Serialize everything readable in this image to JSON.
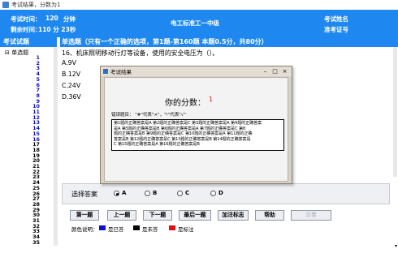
{
  "window": {
    "title": "考试结果，分数为1"
  },
  "header": {
    "exam_time_label": "考试时间：",
    "exam_time_value": "120",
    "exam_time_unit": "分钟",
    "remaining_label": "剩余时间：",
    "remaining_value": "110 分 23秒",
    "center_title": "电工标准工一中级",
    "name_label": "考试姓名",
    "id_label": "准考证号"
  },
  "sidebar": {
    "title": "考试试题",
    "root": "单选题",
    "numbers": [
      "1",
      "2",
      "3",
      "4",
      "5",
      "6",
      "7",
      "8",
      "9",
      "10",
      "11",
      "12",
      "13",
      "14",
      "15",
      "16",
      "17",
      "18",
      "19",
      "20",
      "21",
      "22",
      "23",
      "24",
      "25",
      "26",
      "27",
      "28",
      "29",
      "30",
      "31",
      "32",
      "33",
      "34",
      "35"
    ]
  },
  "question": {
    "section_header": "单选题（只有一个正确的选项，第1题-第160题 本题0.5分，共80分）",
    "text": "16、机床照明移动行灯等设备，使用的安全电压为（）。",
    "options": [
      "A.9V",
      "B.12V",
      "C.24V",
      "D.36V"
    ]
  },
  "answer": {
    "label": "选择答案",
    "choices": [
      "A",
      "B",
      "C",
      "D"
    ],
    "selected": "A"
  },
  "buttons": {
    "prev": "第一题",
    "up": "上一题",
    "next": "下一题",
    "last": "最后一题",
    "flag": "加注标志",
    "help": "帮助",
    "submit": "交卷"
  },
  "legend": {
    "label": "颜色说明：",
    "items": [
      {
        "color": "#1010c8",
        "label": "是已答"
      },
      {
        "color": "#000000",
        "label": "是未答"
      },
      {
        "color": "#e01010",
        "label": "是标注"
      }
    ]
  },
  "dialog": {
    "title": "考试结果",
    "score_label": "你的分数：",
    "score_value": "1",
    "hint": "错误题目：          \"#\"代表\"×\"，\"!\"代表\"√\"",
    "result_lines": [
      "第1题的正确答案是A  第2题的正确答案是C  第3题的正确答案是A  第4题的正确答案",
      "是A  第5题的正确答案是B  第6题的正确答案是A  第7题的正确答案是C  第8",
      "题的正确答案是B  第9题的正确答案是C  第10题的正确答案是A  第11题的正确",
      "答案是B  第12题的正确答案是C  第13题的正确答案是B  第14题的正确答案是",
      "C  第15题的正确答案是A  第16题的正确答案是B"
    ]
  }
}
